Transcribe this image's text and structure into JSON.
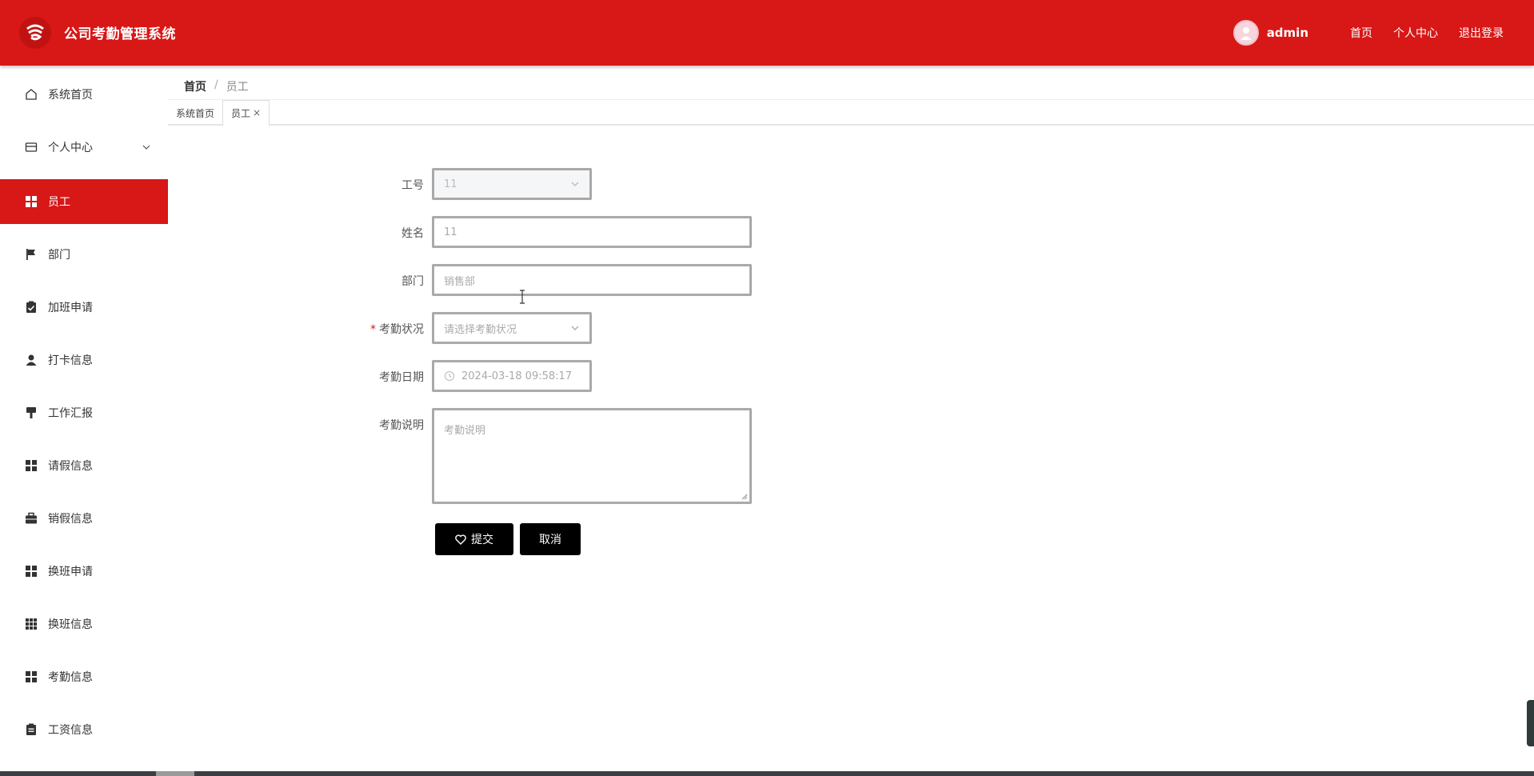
{
  "header": {
    "app_title": "公司考勤管理系统",
    "username": "admin",
    "links": [
      "首页",
      "个人中心",
      "退出登录"
    ]
  },
  "sidebar": {
    "items": [
      {
        "label": "系统首页",
        "icon": "home-icon"
      },
      {
        "label": "个人中心",
        "icon": "wallet-icon",
        "expandable": true
      },
      {
        "label": "员工",
        "icon": "grid-icon",
        "active": true
      },
      {
        "label": "部门",
        "icon": "flag-icon"
      },
      {
        "label": "加班申请",
        "icon": "clipboard-check-icon"
      },
      {
        "label": "打卡信息",
        "icon": "user-icon"
      },
      {
        "label": "工作汇报",
        "icon": "brush-icon"
      },
      {
        "label": "请假信息",
        "icon": "grid-icon"
      },
      {
        "label": "销假信息",
        "icon": "briefcase-icon"
      },
      {
        "label": "换班申请",
        "icon": "grid-icon"
      },
      {
        "label": "换班信息",
        "icon": "apps-icon"
      },
      {
        "label": "考勤信息",
        "icon": "grid-icon"
      },
      {
        "label": "工资信息",
        "icon": "clipboard-icon"
      }
    ]
  },
  "breadcrumb": {
    "home": "首页",
    "separator": "/",
    "current": "员工"
  },
  "tabs": [
    {
      "label": "系统首页"
    },
    {
      "label": "员工",
      "active": true,
      "close": "×"
    }
  ],
  "form": {
    "emp_no": {
      "label": "工号",
      "value": "11"
    },
    "name": {
      "label": "姓名",
      "value": "11"
    },
    "dept": {
      "label": "部门",
      "value": "销售部"
    },
    "status": {
      "label": "考勤状况",
      "placeholder": "请选择考勤状况",
      "required": "*"
    },
    "date": {
      "label": "考勤日期",
      "value": "2024-03-18 09:58:17"
    },
    "note": {
      "label": "考勤说明",
      "placeholder": "考勤说明"
    }
  },
  "buttons": {
    "submit": "提交",
    "cancel": "取消"
  },
  "colors": {
    "primary": "#d81717",
    "button": "#000000"
  }
}
